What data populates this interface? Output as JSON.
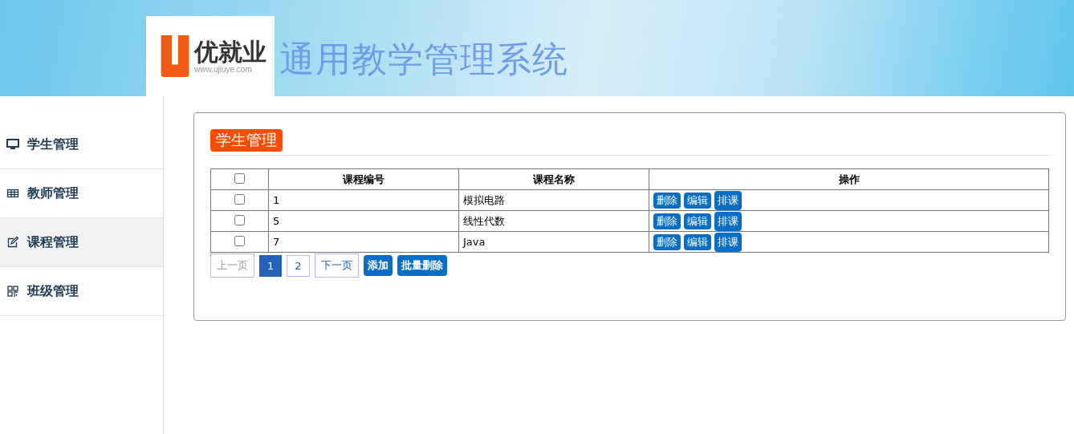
{
  "header": {
    "logo": {
      "name": "优就业",
      "url": "www.ujiuye.com"
    },
    "title": "通用教学管理系统"
  },
  "sidebar": {
    "items": [
      {
        "label": "学生管理",
        "selected": false
      },
      {
        "label": "教师管理",
        "selected": false
      },
      {
        "label": "课程管理",
        "selected": true
      },
      {
        "label": "班级管理",
        "selected": false
      }
    ]
  },
  "panel": {
    "title": "学生管理",
    "table": {
      "select_all": {
        "checked": false
      },
      "columns": [
        "课程编号",
        "课程名称",
        "操作"
      ],
      "rows": [
        {
          "checked": false,
          "id": "1",
          "name": "模拟电路",
          "actions": [
            "删除",
            "编辑",
            "排课"
          ]
        },
        {
          "checked": false,
          "id": "5",
          "name": "线性代数",
          "actions": [
            "删除",
            "编辑",
            "排课"
          ]
        },
        {
          "checked": false,
          "id": "7",
          "name": "Java",
          "actions": [
            "删除",
            "编辑",
            "排课"
          ]
        }
      ]
    },
    "pagination": {
      "prev": {
        "label": "上一页",
        "disabled": true
      },
      "pages": [
        {
          "label": "1",
          "selected": true
        },
        {
          "label": "2",
          "selected": false
        }
      ],
      "next": {
        "label": "下一页",
        "disabled": false
      }
    },
    "buttons": [
      "添加",
      "批量删除"
    ]
  }
}
